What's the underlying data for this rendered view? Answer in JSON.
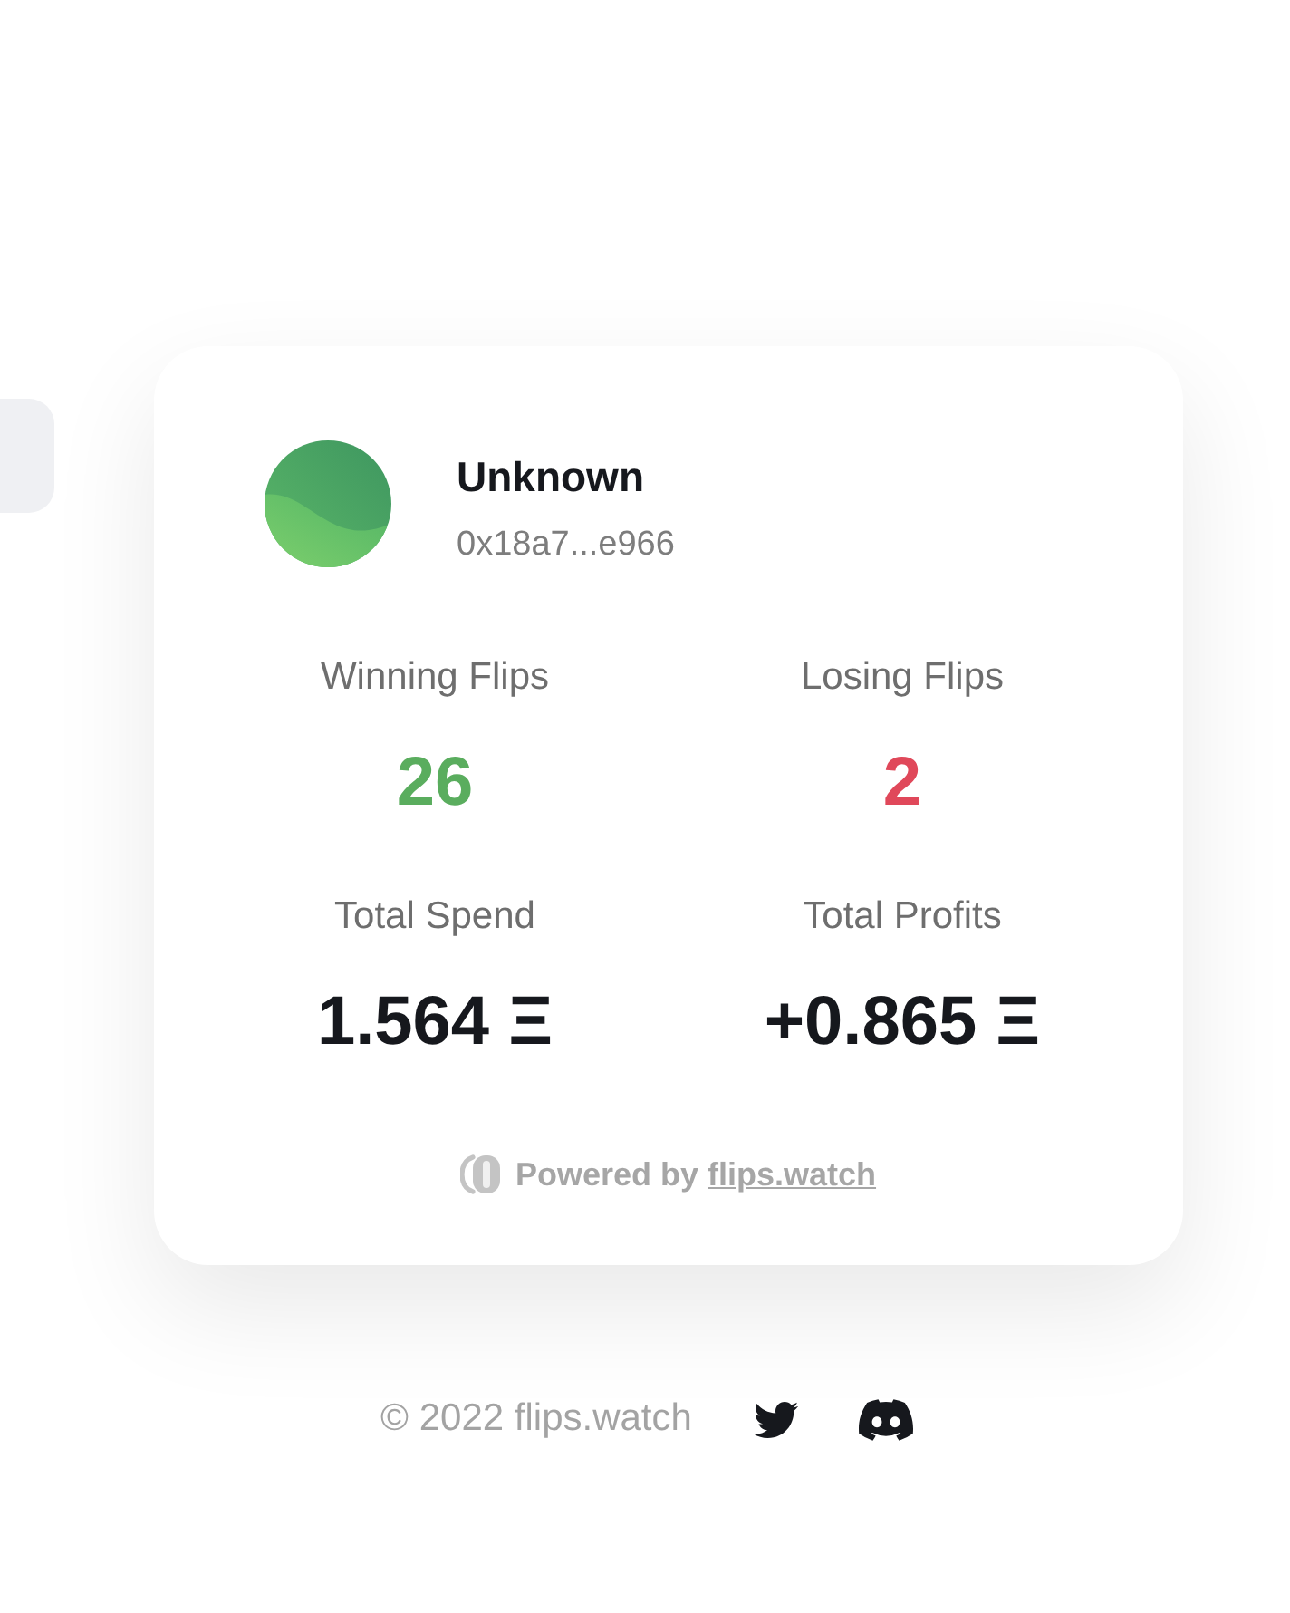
{
  "profile": {
    "name": "Unknown",
    "address": "0x18a7...e966"
  },
  "stats": [
    {
      "label": "Winning Flips",
      "value": "26",
      "color": "#5aad5e"
    },
    {
      "label": "Losing Flips",
      "value": "2",
      "color": "#e0485a"
    },
    {
      "label": "Total Spend",
      "value": "1.564 Ξ",
      "color": "#16181d"
    },
    {
      "label": "Total Profits",
      "value": "+0.865 Ξ",
      "color": "#16181d"
    }
  ],
  "powered_by": {
    "prefix": "Powered by",
    "link": "flips.watch"
  },
  "footer": {
    "copyright": "© 2022 flips.watch"
  }
}
